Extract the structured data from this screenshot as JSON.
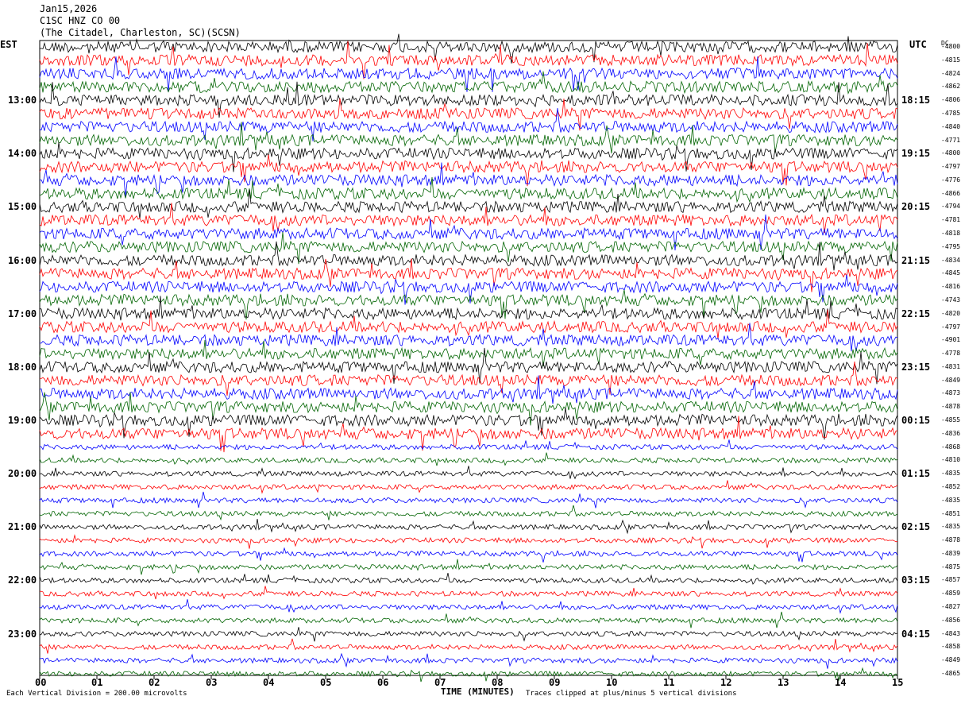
{
  "header": {
    "date": "Jan15,2026",
    "channel": "C1SC HNZ CO 00",
    "station": "(The Citadel, Charleston, SC)(SCSN)"
  },
  "left_axis_label": "EST",
  "right_axis_label": "UTC",
  "dc_label": "DC",
  "footer": {
    "scale_note": "Each Vertical Division = 200.00 microvolts",
    "xlabel": "TIME (MINUTES)",
    "clip_note": "Traces clipped at plus/minus 5 vertical divisions"
  },
  "colors": {
    "trace_cycle": [
      "#000000",
      "#ff0000",
      "#0000ff",
      "#006400"
    ],
    "frame": "#000000"
  },
  "chart_data": {
    "type": "line",
    "title": "",
    "xlabel": "TIME (MINUTES)",
    "xlim": [
      0,
      15
    ],
    "x_ticks": [
      "00",
      "01",
      "02",
      "03",
      "04",
      "05",
      "06",
      "07",
      "08",
      "09",
      "10",
      "11",
      "12",
      "13",
      "14",
      "15"
    ],
    "rows_per_hour": 4,
    "rows_total": 48,
    "left_hour_labels": [
      "13:00",
      "14:00",
      "15:00",
      "16:00",
      "17:00",
      "18:00",
      "19:00",
      "20:00",
      "21:00",
      "22:00",
      "23:00"
    ],
    "right_hour_labels": [
      "18:15",
      "19:15",
      "20:15",
      "21:15",
      "22:15",
      "23:15",
      "00:15",
      "01:15",
      "02:15",
      "03:15",
      "04:15"
    ],
    "first_labeled_row": 4,
    "row_dc_offsets": [
      "-4800",
      "-4815",
      "-4824",
      "-4862",
      "-4806",
      "-4785",
      "-4840",
      "-4771",
      "-4800",
      "-4797",
      "-4776",
      "-4866",
      "-4794",
      "-4781",
      "-4818",
      "-4795",
      "-4834",
      "-4845",
      "-4816",
      "-4743",
      "-4820",
      "-4797",
      "-4901",
      "-4778",
      "-4831",
      "-4849",
      "-4873",
      "-4878",
      "-4855",
      "-4836",
      "-4868",
      "-4810",
      "-4835",
      "-4852",
      "-4835",
      "-4851",
      "-4835",
      "-4878",
      "-4839",
      "-4875",
      "-4857",
      "-4859",
      "-4827",
      "-4856",
      "-4843",
      "-4858",
      "-4849",
      "-4865"
    ]
  }
}
